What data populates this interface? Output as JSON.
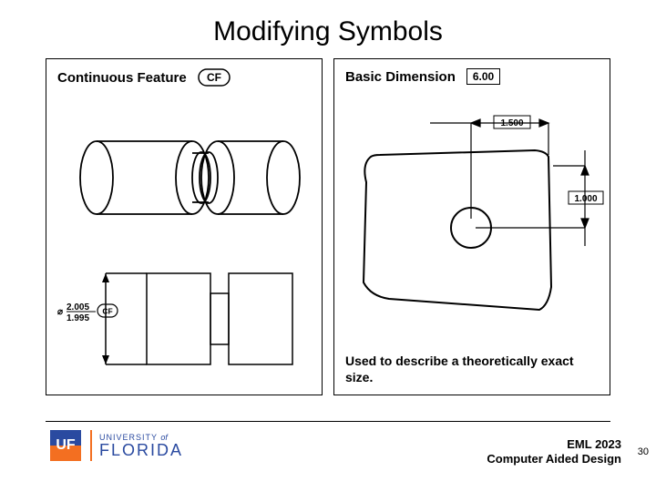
{
  "title": "Modifying Symbols",
  "left": {
    "header": "Continuous Feature",
    "cf_label": "CF",
    "dim_upper": "2.005",
    "dim_lower": "1.995"
  },
  "right": {
    "header": "Basic Dimension",
    "bd_value": "6.00",
    "dim_h": "1.500",
    "dim_v": "1.000",
    "footer": "Used to describe a theoretically exact size."
  },
  "footer": {
    "logo_mark": "UF",
    "logo_uni_pre": "UNIVERSITY ",
    "logo_uni_of": "of",
    "logo_fl": "FLORIDA",
    "course_code": "EML 2023",
    "course_name": "Computer Aided Design",
    "page": "30"
  }
}
